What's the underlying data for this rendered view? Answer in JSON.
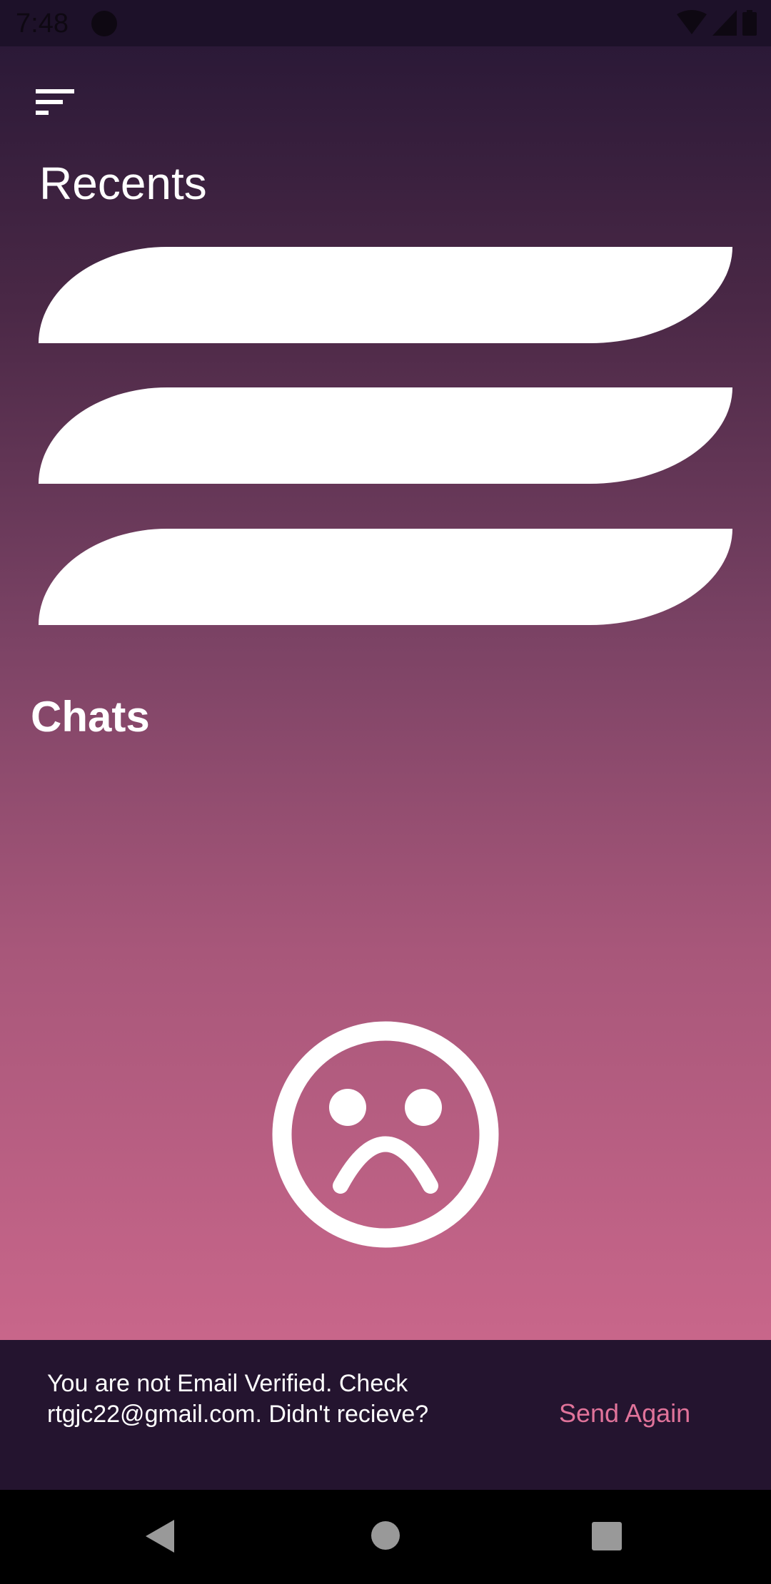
{
  "status_bar": {
    "time": "7:48",
    "icons": [
      "app-notification-icon",
      "wifi-icon",
      "signal-icon",
      "battery-icon"
    ]
  },
  "header": {
    "menu_icon": "sort-menu-icon",
    "recents_title": "Recents"
  },
  "recents": {
    "items": [
      {},
      {},
      {}
    ]
  },
  "chats": {
    "title": "Chats",
    "empty_icon": "sad-face-icon"
  },
  "snackbar": {
    "message": "You are not Email Verified. Check rtgjc22@gmail.com. Didn't recieve?",
    "action": "Send Again",
    "action_color": "#e0739a"
  },
  "nav_bar": {
    "icons": [
      "back-icon",
      "home-icon",
      "recents-icon"
    ]
  },
  "colors": {
    "gradient_top": "#2b1937",
    "gradient_bottom": "#c8668a",
    "snackbar_bg": "#24142f"
  }
}
